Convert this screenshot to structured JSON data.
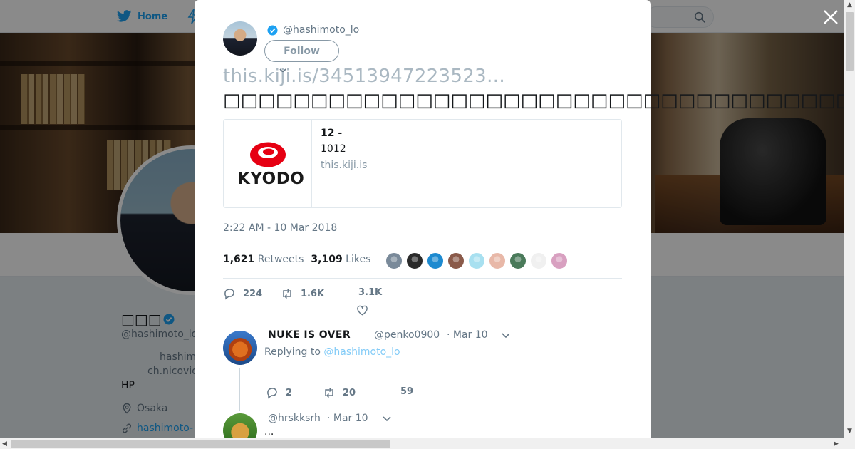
{
  "nav": {
    "home_label": "Home"
  },
  "profile": {
    "name": "□□□",
    "handle": "@hashimoto_lo",
    "bio_line1": "hashim",
    "bio_line2": "ch.nicovid",
    "bio_line3": "HP",
    "location": "Osaka",
    "link": "hashimoto-"
  },
  "tweet": {
    "author_handle": "@hashimoto_lo",
    "follow_label": "Follow",
    "link_text": "this.kiji.is/34513947223523…",
    "body_text": "□□□□□□□□□□□□□□□□□□□□□□□□□□□□□□□□□□□□□□□□□□□□□□□□□□□",
    "card": {
      "logo_text": "KYODO",
      "title": "12 -",
      "description": "1012",
      "domain": "this.kiji.is"
    },
    "timestamp": "2:22 AM - 10 Mar 2018",
    "retweets_count": "1,621",
    "retweets_label": "Retweets",
    "likes_count": "3,109",
    "likes_label": "Likes",
    "liker_colors": [
      "#7a8a9a",
      "#2a2a2a",
      "#1d8ad0",
      "#8a5a4a",
      "#a8e0f0",
      "#e8b8a8",
      "#4a7a5a",
      "#f0f0f0",
      "#d8a0c0"
    ],
    "actions": {
      "replies": "224",
      "retweets": "1.6K",
      "likes": "3.1K"
    }
  },
  "replies": [
    {
      "name": "NUKE IS OVER",
      "handle": "@penko0900",
      "time": "· Mar 10",
      "replying_prefix": "Replying to",
      "replying_to": "@hashimoto_lo",
      "reply_count": "2",
      "retweet_count": "20",
      "like_count": "59"
    },
    {
      "handle": "@hrskksrh",
      "time": "· Mar 10",
      "text": "..."
    }
  ]
}
